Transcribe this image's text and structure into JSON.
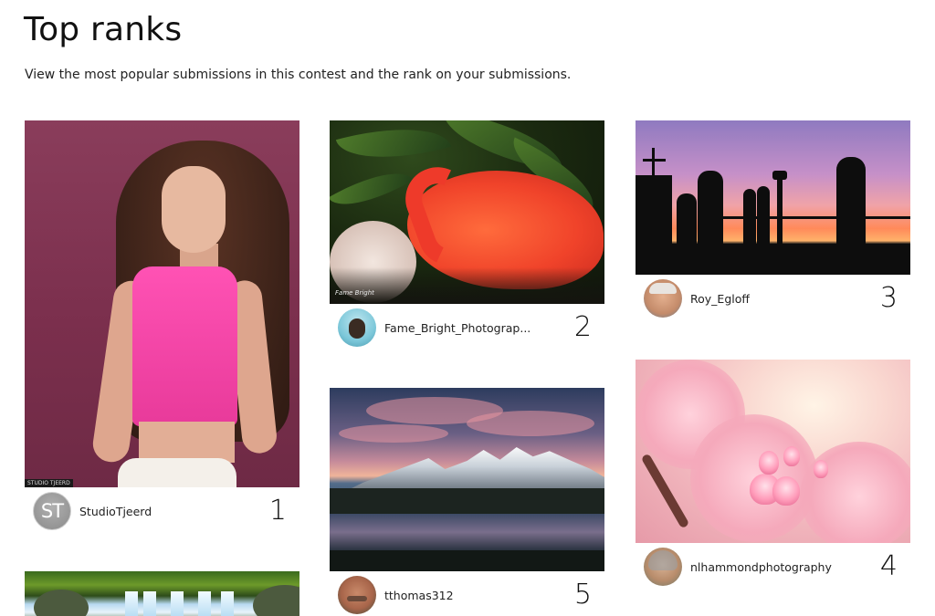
{
  "header": {
    "title": "Top ranks",
    "subtitle": "View the most popular submissions in this contest and the rank on your submissions."
  },
  "submissions": [
    {
      "username": "StudioTjeerd",
      "rank": "1",
      "avatar_initials": "ST",
      "photo_watermark": "STUDIO TJEERD"
    },
    {
      "username": "Fame_Bright_Photograp...",
      "rank": "2",
      "photo_signature": "Fame Bright"
    },
    {
      "username": "Roy_Egloff",
      "rank": "3"
    },
    {
      "username": "nlhammondphotography",
      "rank": "4"
    },
    {
      "username": "tthomas312",
      "rank": "5"
    },
    {
      "username": "",
      "rank": ""
    }
  ]
}
